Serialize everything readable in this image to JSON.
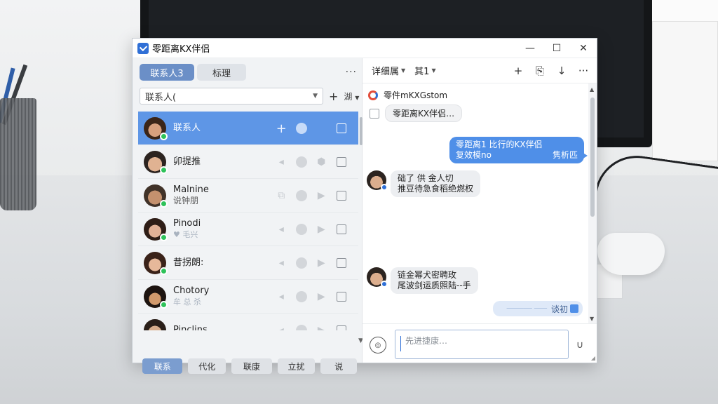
{
  "window": {
    "title": "零距离KX伴侣",
    "controls": {
      "minimize": "—",
      "maximize": "☐",
      "close": "✕"
    }
  },
  "left": {
    "tabs": [
      {
        "label": "联系人3",
        "active": true
      },
      {
        "label": "标理",
        "active": false
      }
    ],
    "more": "···",
    "filter": {
      "value": "联系人(",
      "add": "+",
      "sort": "湖"
    },
    "contacts": [
      {
        "name": "联系人",
        "sub": "",
        "selected": true,
        "avatar_color": "#c8906f",
        "hair": "#3b2518"
      },
      {
        "name": "卯提推",
        "sub": "",
        "selected": false,
        "avatar_color": "#d6a782",
        "hair": "#2c2420"
      },
      {
        "name": "Malnine",
        "sub": "说钟朋",
        "selected": false,
        "avatar_color": "#b98565",
        "hair": "#403228"
      },
      {
        "name": "Pinodi",
        "sub": "♥ 毛兴",
        "sub_faint": true,
        "selected": false,
        "avatar_color": "#d9a78a",
        "hair": "#2e1d16"
      },
      {
        "name": "昔拐朗:",
        "sub": "",
        "selected": false,
        "avatar_color": "#dcab8e",
        "hair": "#3a2219"
      },
      {
        "name": "Chotory",
        "sub": "牟 总 杀",
        "sub_faint": true,
        "selected": false,
        "avatar_color": "#c08a5e",
        "hair": "#1d1410"
      },
      {
        "name": "Pinclins",
        "sub": "",
        "selected": false,
        "avatar_color": "#caa080",
        "hair": "#2a1f19"
      }
    ],
    "bottom_tabs": [
      {
        "label": "联系",
        "active": true
      },
      {
        "label": "代化",
        "active": false
      },
      {
        "label": "联康",
        "active": false
      },
      {
        "label": "立扰",
        "active": false
      },
      {
        "label": "说",
        "active": false
      }
    ]
  },
  "right": {
    "header": {
      "item1": "详细属",
      "item2": "其1",
      "tools": [
        "+",
        "⎘",
        "↓",
        "···"
      ]
    },
    "system": {
      "line": "零件mKXGstom",
      "pill": "零距离KX伴侣…"
    },
    "outgoing": {
      "line1": "零距离1 比行的KX伴侣",
      "line2_left": "复效模no",
      "line2_right": "隽析匹"
    },
    "incoming": [
      {
        "line1": "础了 供 金人切",
        "line2": "推豆待急食稻绝燃权"
      },
      {
        "line1": "链金幂犬密聘玫",
        "line2": "尾波剑运质照陆--手"
      }
    ],
    "small_out": {
      "blur": "────── ───",
      "label": "谈初"
    },
    "composer": {
      "placeholder": "先进捷康…",
      "voice": "◎",
      "emoji": "∪"
    }
  },
  "colors": {
    "accent": "#5e96e6",
    "online": "#2ec25a",
    "bubble_out": "#4f8fe8"
  }
}
